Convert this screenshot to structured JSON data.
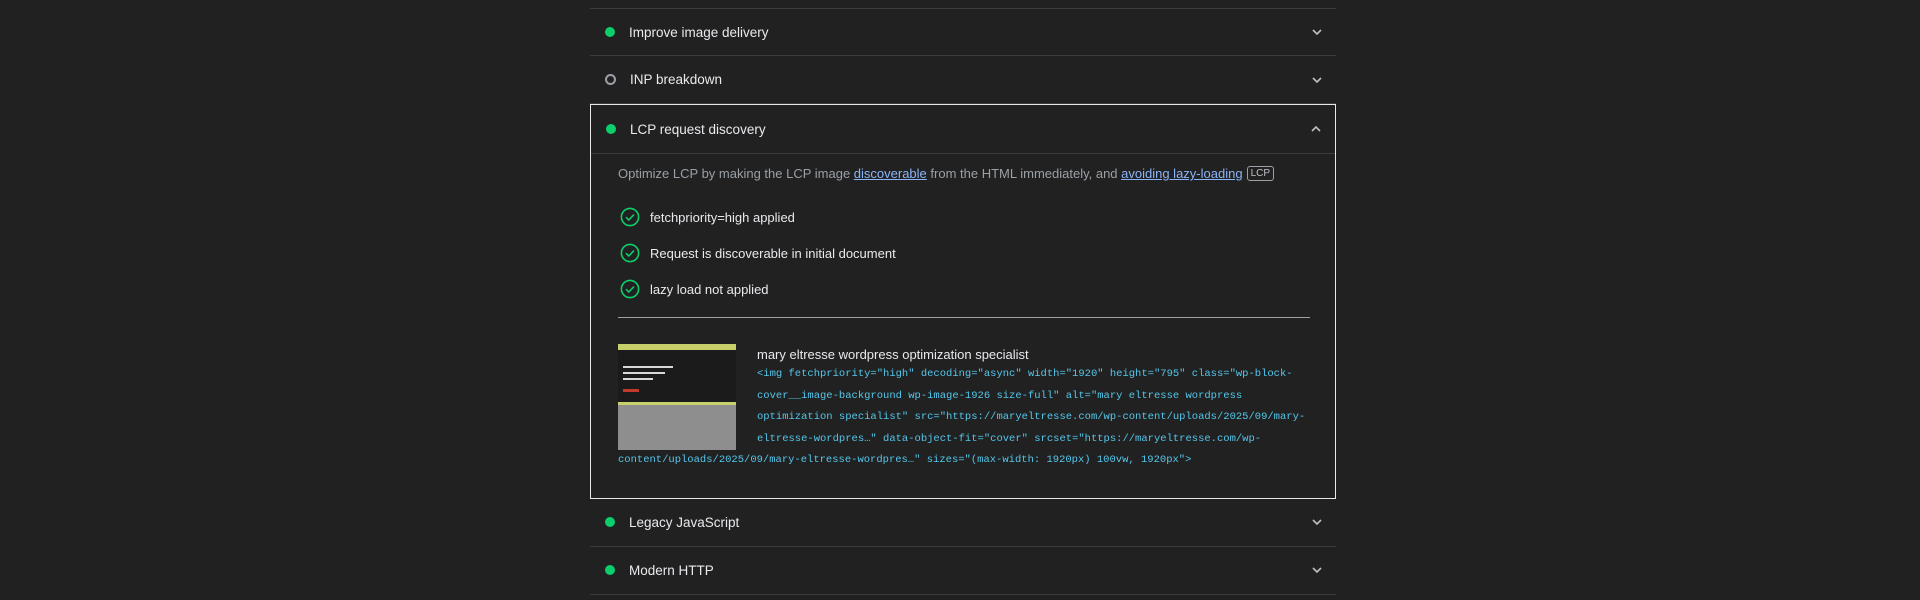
{
  "audits_top": [
    {
      "title": "Improve image delivery",
      "status": "pass"
    },
    {
      "title": "INP breakdown",
      "status": "info"
    }
  ],
  "expanded": {
    "title": "LCP request discovery",
    "status": "pass",
    "desc_prefix": "Optimize LCP by making the LCP image ",
    "desc_link1": "discoverable",
    "desc_middle": " from the HTML immediately, and ",
    "desc_link2": "avoiding lazy-loading",
    "badge": "LCP",
    "checks": [
      "fetchpriority=high applied",
      "Request is discoverable in initial document",
      "lazy load not applied"
    ],
    "node": {
      "title": "mary eltresse wordpress optimization specialist",
      "snippet": "<img fetchpriority=\"high\" decoding=\"async\" width=\"1920\" height=\"795\" class=\"wp-block-cover__image-background wp-image-1926 size-full\" alt=\"mary eltresse wordpress optimization specialist\" src=\"https://maryeltresse.com/wp-content/uploads/2025/09/mary-eltresse-wordpres…\" data-object-fit=\"cover\" srcset=\"https://maryeltresse.com/wp-content/uploads/2025/09/mary-eltresse-wordpres…\" sizes=\"(max-width: 1920px) 100vw, 1920px\">"
    }
  },
  "audits_bottom": [
    {
      "title": "Legacy JavaScript",
      "status": "pass"
    },
    {
      "title": "Modern HTTP",
      "status": "pass"
    }
  ],
  "colors": {
    "pass": "#0cce6b",
    "link": "#8ab4f8",
    "code": "#54c7ec",
    "background": "#212121"
  }
}
